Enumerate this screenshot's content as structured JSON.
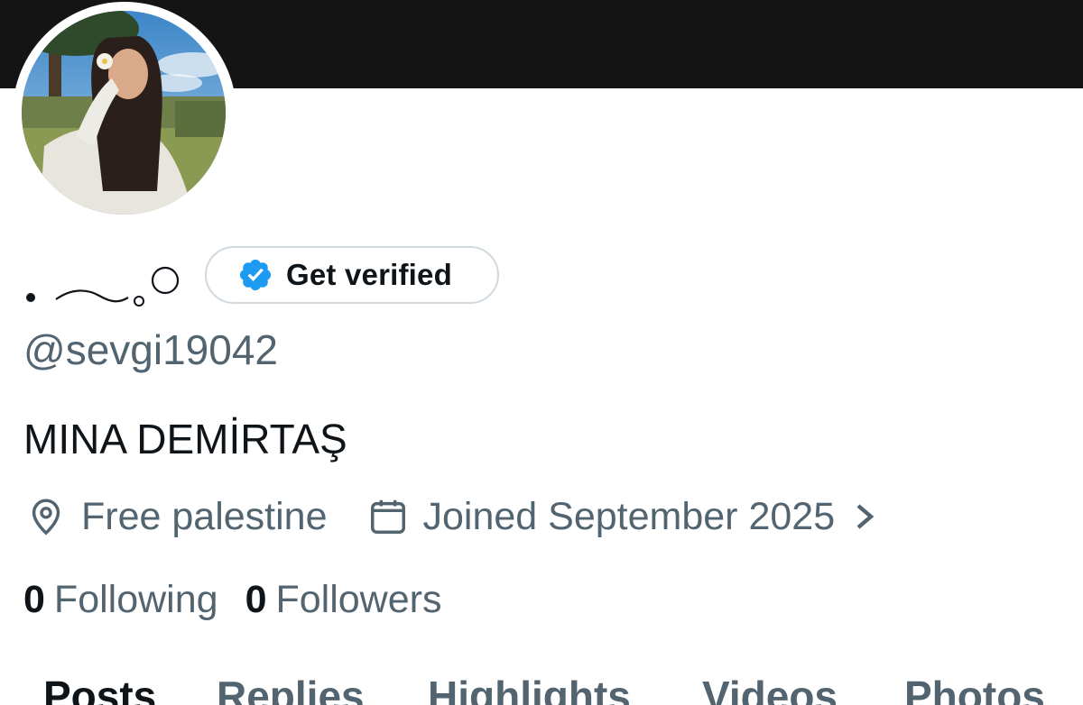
{
  "profile": {
    "display_name_graphic": "display-name-dot-wave-circle",
    "get_verified_label": "Get verified",
    "handle": "@sevgi19042",
    "bio": "MINA DEMİRTAŞ",
    "location": "Free palestine",
    "joined": "Joined September 2025",
    "following_count": "0",
    "following_label": "Following",
    "followers_count": "0",
    "followers_label": "Followers"
  },
  "tabs": [
    {
      "label": "Posts",
      "active": true
    },
    {
      "label": "Replies",
      "active": false
    },
    {
      "label": "Highlights",
      "active": false
    },
    {
      "label": "Videos",
      "active": false
    },
    {
      "label": "Photos",
      "active": false
    }
  ],
  "colors": {
    "banner": "#141414",
    "primary_text": "#0f1419",
    "secondary_text": "#536471",
    "verified_blue": "#1d9bf0",
    "border": "#cfd9de"
  },
  "icons": {
    "verified": "verified-badge-icon",
    "location": "location-pin-icon",
    "calendar": "calendar-icon",
    "chevron": "chevron-right-icon"
  }
}
